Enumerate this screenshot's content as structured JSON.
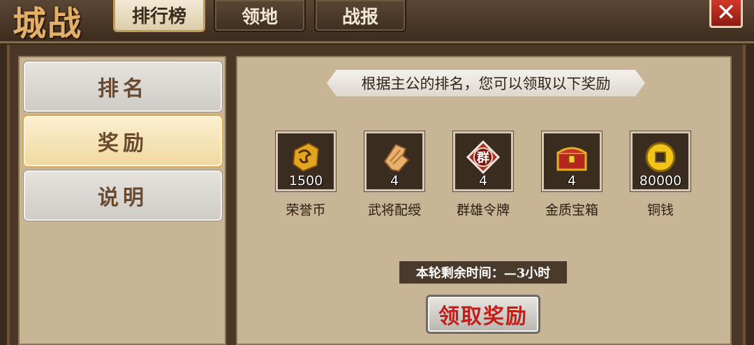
{
  "header": {
    "title": "城战",
    "tabs": [
      {
        "label": "排行榜",
        "active": true
      },
      {
        "label": "领地",
        "active": false
      },
      {
        "label": "战报",
        "active": false
      }
    ],
    "close_icon": "close-icon"
  },
  "sidebar": {
    "items": [
      {
        "label": "排名",
        "selected": false
      },
      {
        "label": "奖励",
        "selected": true
      },
      {
        "label": "说明",
        "selected": false
      }
    ]
  },
  "main": {
    "banner": "根据主公的排名，您可以领取以下奖励",
    "rewards": [
      {
        "name": "荣誉币",
        "count": "1500",
        "icon": "honor-coin-icon"
      },
      {
        "name": "武将配绶",
        "count": "4",
        "icon": "ribbon-token-icon"
      },
      {
        "name": "群雄令牌",
        "count": "4",
        "icon": "qunxiong-token-icon",
        "icon_text": "群"
      },
      {
        "name": "金质宝箱",
        "count": "4",
        "icon": "gold-chest-icon"
      },
      {
        "name": "铜钱",
        "count": "80000",
        "icon": "copper-coin-icon"
      }
    ],
    "timer": "本轮剩余时间：—3小时",
    "claim_button": "领取奖励"
  },
  "colors": {
    "accent_red": "#c21f1a",
    "title_gold": "#e3b06a",
    "panel_bg": "#c8b596"
  }
}
